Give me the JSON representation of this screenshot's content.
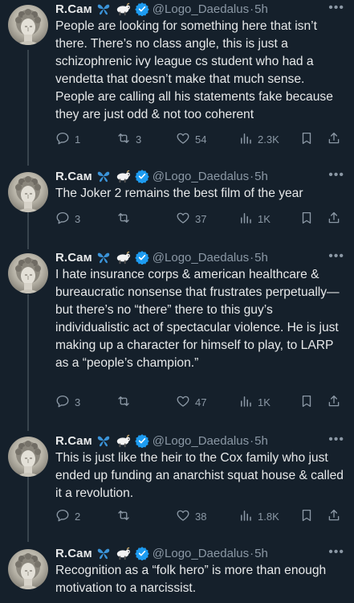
{
  "author": {
    "name": "R.Cам",
    "handle": "@Logo_Daedalus",
    "sep": "·"
  },
  "tweets": [
    {
      "time": "5h",
      "text": "People are looking for something here that isn’t there. There’s no class angle, this is just a schizophrenic ivy league cs student who had a vendetta that doesn’t make that much sense. People are calling all his statements fake because they are just odd & not too coherent",
      "replies": "1",
      "retweets": "3",
      "likes": "54",
      "views": "2.3K"
    },
    {
      "time": "5h",
      "text": "The Joker 2 remains the best film of the year",
      "replies": "3",
      "retweets": "",
      "likes": "37",
      "views": "1K"
    },
    {
      "time": "5h",
      "text": "I hate insurance corps & american healthcare & bureaucratic nonsense that frustrates perpetually— but there’s no “there” there to this guy’s individualistic act of spectacular violence. He is just making up a character for himself to play, to LARP as a “people’s champion.”",
      "replies": "3",
      "retweets": "",
      "likes": "47",
      "views": "1K"
    },
    {
      "time": "5h",
      "text": "This is just like the heir to the Cox family who just ended up funding an anarchist squat house & called it a revolution.",
      "replies": "2",
      "retweets": "",
      "likes": "38",
      "views": "1.8K"
    },
    {
      "time": "5h",
      "text": "Recognition as a “folk hero” is more than enough motivation to a narcissist."
    }
  ],
  "icons": [
    "reply-icon",
    "retweet-icon",
    "like-icon",
    "views-icon",
    "bookmark-icon",
    "share-icon"
  ],
  "colors": {
    "background": "#15202b",
    "text": "#e7e9ea",
    "muted": "#8b98a5",
    "verified": "#1d9bf0",
    "butterfly": "#3b94d9"
  }
}
